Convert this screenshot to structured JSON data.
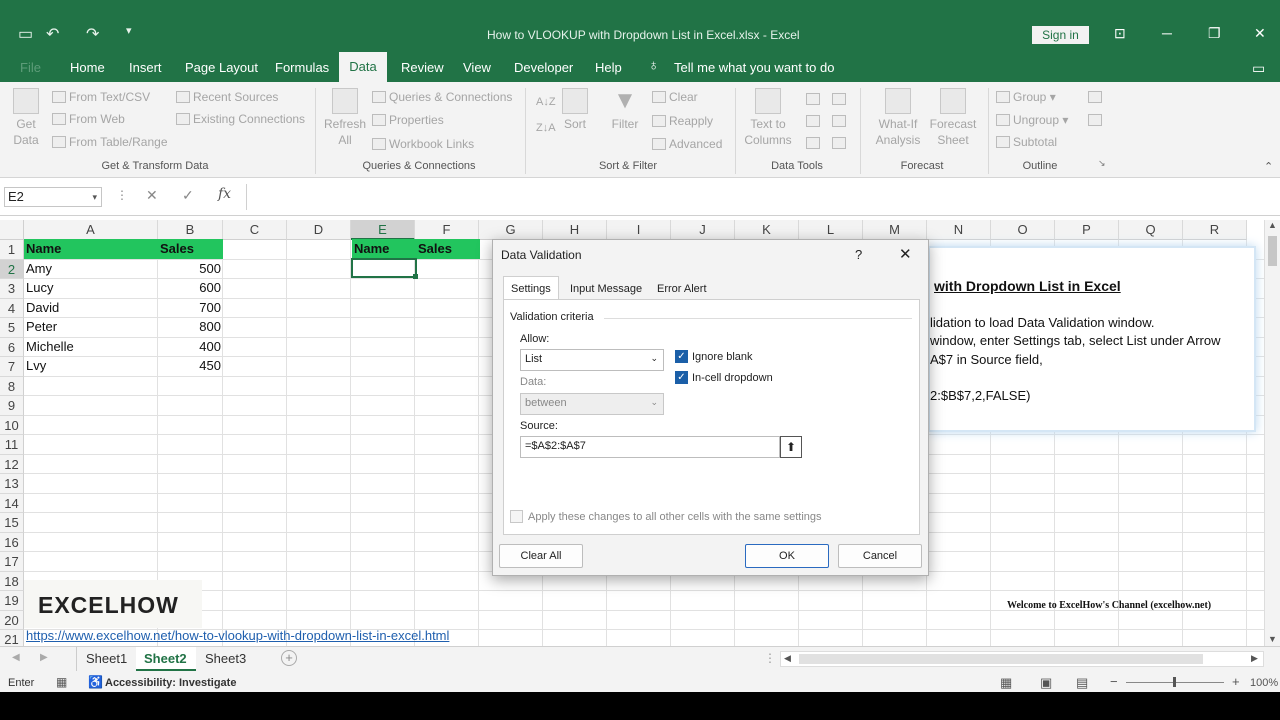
{
  "title": {
    "text": "How to VLOOKUP with Dropdown List in Excel.xlsx  -  Excel",
    "signin": "Sign in"
  },
  "menu": {
    "file": "File",
    "tabs": [
      "Home",
      "Insert",
      "Page Layout",
      "Formulas",
      "Data",
      "Review",
      "View",
      "Developer",
      "Help"
    ],
    "active": "Data",
    "tellme": "Tell me what you want to do"
  },
  "ribbon": {
    "get_data": "Get\nData",
    "from_text": "From Text/CSV",
    "from_web": "From Web",
    "from_table": "From Table/Range",
    "recent_sources": "Recent Sources",
    "existing_connections": "Existing Connections",
    "g1": "Get & Transform Data",
    "refresh_all": "Refresh\nAll",
    "queries_connections": "Queries & Connections",
    "properties": "Properties",
    "workbook_links": "Workbook Links",
    "g2": "Queries & Connections",
    "sort": "Sort",
    "filter": "Filter",
    "clear": "Clear",
    "reapply": "Reapply",
    "advanced": "Advanced",
    "g3": "Sort & Filter",
    "text_to_columns": "Text to\nColumns",
    "g4": "Data Tools",
    "what_if": "What-If\nAnalysis",
    "forecast_sheet": "Forecast\nSheet",
    "g5": "Forecast",
    "group": "Group",
    "ungroup": "Ungroup",
    "subtotal": "Subtotal",
    "g6": "Outline"
  },
  "formula_bar": {
    "name_box": "E2",
    "fx": "fx",
    "value": ""
  },
  "grid": {
    "columns": [
      "A",
      "B",
      "C",
      "D",
      "E",
      "F",
      "G",
      "H",
      "I",
      "J",
      "K",
      "L",
      "M",
      "N",
      "O",
      "P",
      "Q",
      "R"
    ],
    "rows": [
      "1",
      "2",
      "3",
      "4",
      "5",
      "6",
      "7",
      "8",
      "9",
      "10",
      "11",
      "12",
      "13",
      "14",
      "15",
      "16",
      "17",
      "18",
      "19",
      "20",
      "21"
    ],
    "table1": {
      "headers": [
        "Name",
        "Sales"
      ],
      "rows": [
        [
          "Amy",
          "500"
        ],
        [
          "Lucy",
          "600"
        ],
        [
          "David",
          "700"
        ],
        [
          "Peter",
          "800"
        ],
        [
          "Michelle",
          "400"
        ],
        [
          "Lvy",
          "450"
        ]
      ]
    },
    "table2_headers": [
      "Name",
      "Sales"
    ],
    "logo": "EXCELHOW",
    "link": "https://www.excelhow.net/how-to-vlookup-with-dropdown-list-in-excel.html",
    "welcome": "Welcome to ExcelHow's  Channel (excelhow.net)"
  },
  "instructions": {
    "title": "with Dropdown List in Excel",
    "line1": "lidation to load Data Validation window.",
    "line2": "window, enter Settings tab, select List under Arrow",
    "line3": "A$7 in Source field,",
    "line4": "2:$B$7,2,FALSE)"
  },
  "dialog": {
    "title": "Data Validation",
    "help": "?",
    "tabs": [
      "Settings",
      "Input Message",
      "Error Alert"
    ],
    "criteria": "Validation criteria",
    "allow_label": "Allow:",
    "allow_value": "List",
    "data_label": "Data:",
    "data_value": "between",
    "ignore_blank": "Ignore blank",
    "in_cell_dropdown": "In-cell dropdown",
    "source_label": "Source:",
    "source_value": "=$A$2:$A$7",
    "apply_all": "Apply these changes to all other cells with the same settings",
    "clear_all": "Clear All",
    "ok": "OK",
    "cancel": "Cancel"
  },
  "sheets": {
    "tabs": [
      "Sheet1",
      "Sheet2",
      "Sheet3"
    ],
    "active": "Sheet2"
  },
  "status": {
    "mode": "Enter",
    "accessibility": "Accessibility: Investigate",
    "zoom": "100%"
  },
  "colors": {
    "excel_green": "#217346",
    "header_fill": "#22c55e",
    "checkbox_blue": "#1b5fa8"
  }
}
